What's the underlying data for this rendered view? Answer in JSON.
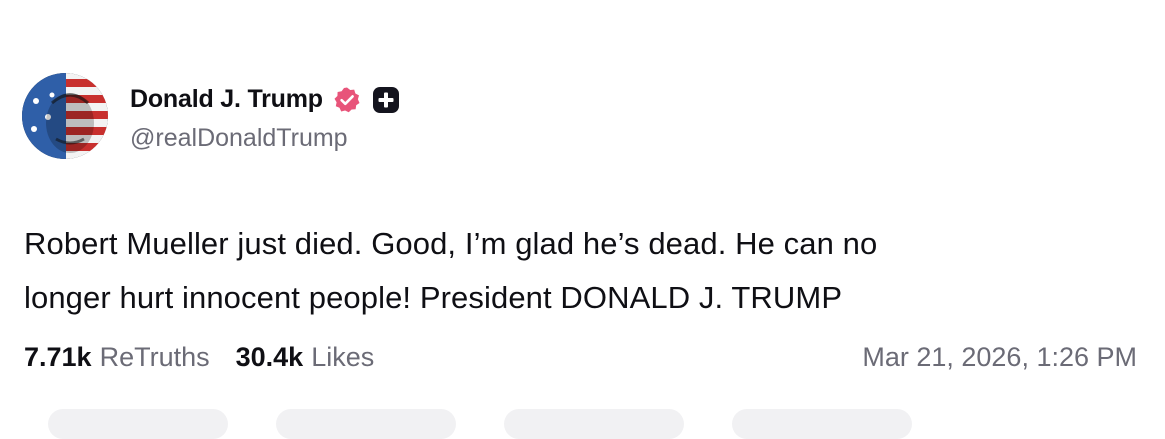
{
  "author": {
    "display_name": "Donald J. Trump",
    "handle": "@realDonaldTrump",
    "verified_icon": "verified-badge-icon",
    "plus_icon": "plus-badge-icon"
  },
  "post": {
    "lines": [
      "Robert Mueller just died. Good, I’m glad he’s dead. He can no",
      "longer hurt innocent people! President DONALD J. TRUMP"
    ]
  },
  "stats": {
    "retruths_count": "7.71k",
    "retruths_label": "ReTruths",
    "likes_count": "30.4k",
    "likes_label": "Likes"
  },
  "timestamp": "Mar 21, 2026, 1:26 PM",
  "colors": {
    "text": "#0f0f14",
    "muted": "#6b6b76",
    "verified_pink": "#e8547a",
    "badge_dark": "#14141e"
  }
}
